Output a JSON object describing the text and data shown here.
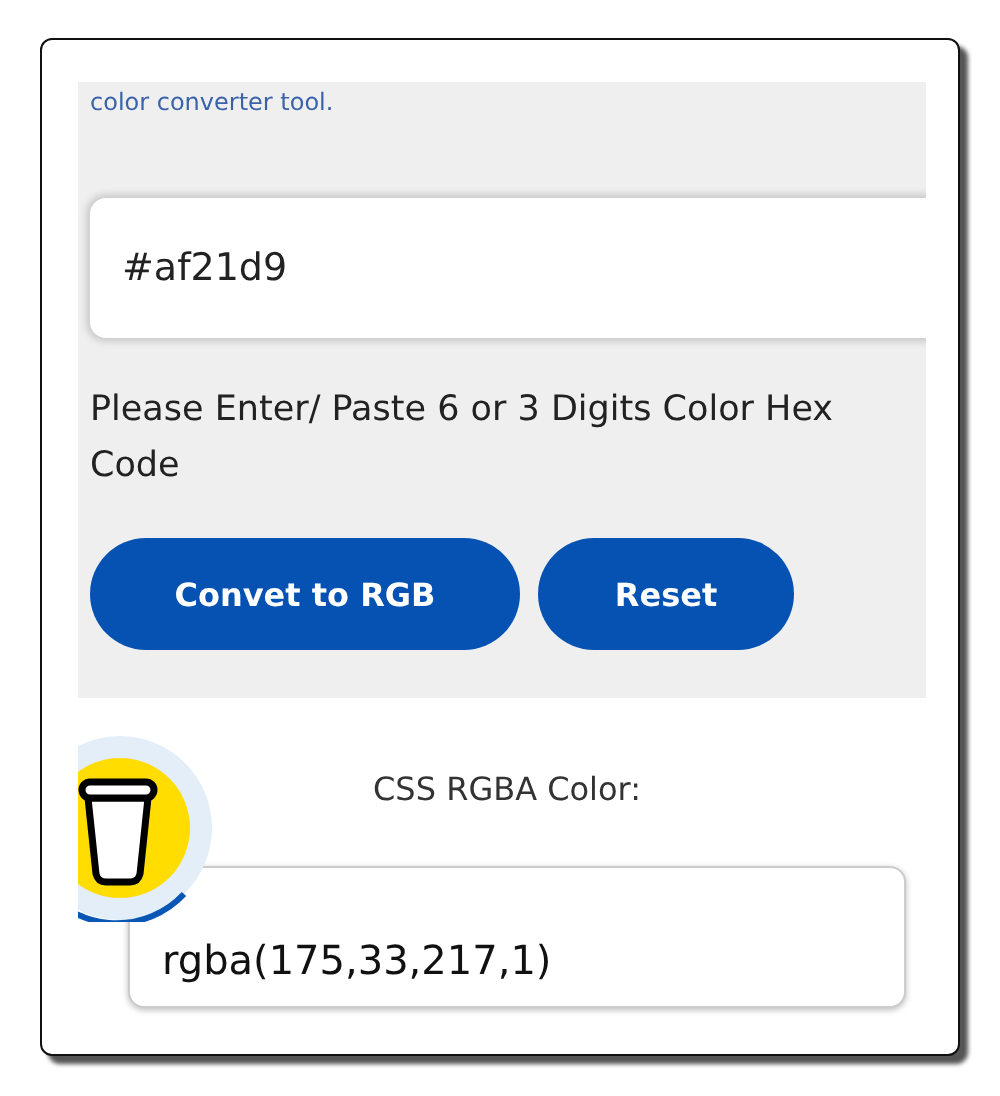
{
  "intro_text": "color converter tool.",
  "hex_input": {
    "value": "#af21d9"
  },
  "hint": "Please Enter/ Paste 6 or 3 Digits Color Hex Code",
  "buttons": [
    {
      "label": "Convet to RGB"
    },
    {
      "label": "Reset"
    }
  ],
  "result": {
    "label": "CSS RGBA Color:",
    "value": "rgba(175,33,217,1)"
  }
}
